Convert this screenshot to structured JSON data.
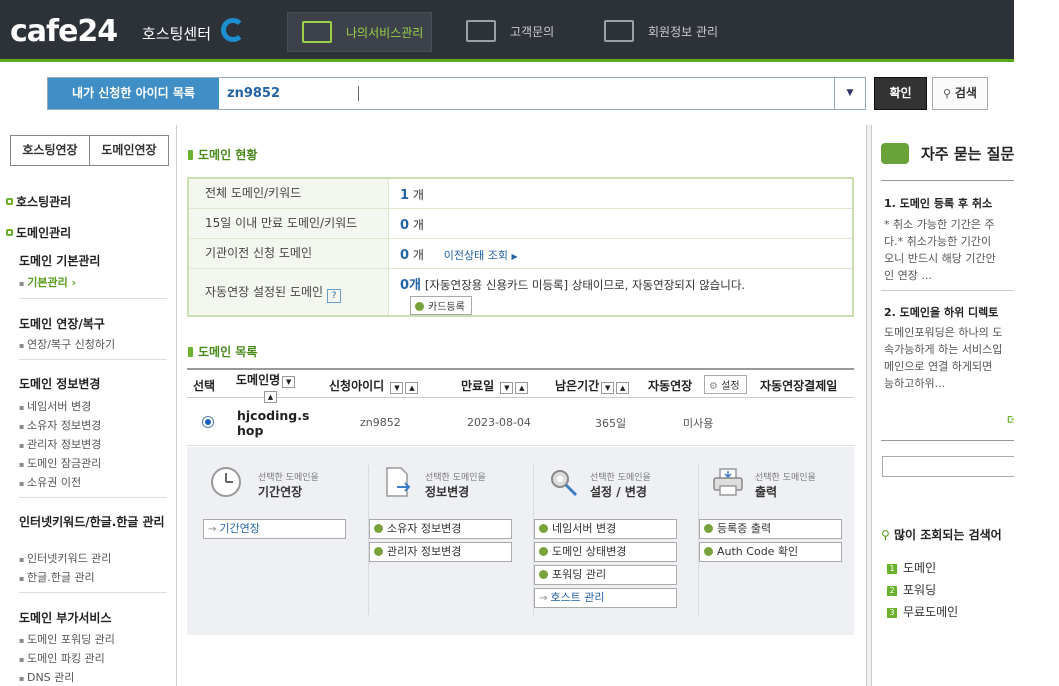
{
  "header": {
    "logo": "cafe24",
    "logo_sub": "호스팅센터",
    "nav": [
      {
        "label": "나의서비스관리",
        "icon": "service-gear-icon"
      },
      {
        "label": "고객문의",
        "icon": "customer-inquiry-icon"
      },
      {
        "label": "회원정보 관리",
        "icon": "member-info-icon"
      }
    ]
  },
  "id_search": {
    "label": "내가 신청한 아이디 목록",
    "value": "zn9852",
    "confirm_label": "확인",
    "search_label": "검색"
  },
  "sidebar": {
    "tabs": [
      "호스팅연장",
      "도메인연장"
    ],
    "sections": [
      "호스팅관리",
      "도메인관리"
    ],
    "groups": [
      {
        "title": "도메인 기본관리",
        "items": [
          "기본관리"
        ]
      },
      {
        "title": "도메인 연장/복구",
        "items": [
          "연장/복구 신청하기"
        ]
      },
      {
        "title": "도메인 정보변경",
        "items": [
          "네임서버 변경",
          "소유자 정보변경",
          "관리자 정보변경",
          "도메인 잠금관리",
          "소유권 이전"
        ]
      },
      {
        "title": "인터넷키워드/한글.한글 관리",
        "items": [
          "인터넷키워드 관리",
          "한글.한글 관리"
        ]
      },
      {
        "title": "도메인 부가서비스",
        "items": [
          "도메인 포워딩 관리",
          "도메인 파킹 관리",
          "DNS 관리"
        ]
      }
    ]
  },
  "domain_status": {
    "title": "도메인 현황",
    "rows": [
      {
        "label": "전체 도메인/키워드",
        "count": "1",
        "unit": "개"
      },
      {
        "label": "15일 이내 만료 도메인/키워드",
        "count": "0",
        "unit": "개"
      },
      {
        "label": "기관이전 신청 도메인",
        "count": "0",
        "unit": "개",
        "link": "이전상태 조회"
      },
      {
        "label": "자동연장 설정된 도메인",
        "count": "0개",
        "note": "[자동연장용 신용카드 미등록] 상태이므로, 자동연장되지 않습니다.",
        "button": "카드등록"
      }
    ]
  },
  "domain_list": {
    "title": "도메인 목록",
    "columns": {
      "select": "선택",
      "domain": "도메인명",
      "id": "신청아이디",
      "expiry": "만료일",
      "remaining": "남은기간",
      "auto_renew": "자동연장",
      "setting": "설정",
      "auto_pay": "자동연장결제일"
    },
    "rows": [
      {
        "domain_line1": "hjcoding.s",
        "domain_line2": "hop",
        "id": "zn9852",
        "expiry": "2023-08-04",
        "remaining": "365일",
        "auto_renew": "미사용"
      }
    ]
  },
  "actions": {
    "subtitle": "선택한 도메인을",
    "columns": [
      {
        "title": "기간연장",
        "icon": "clock-icon",
        "buttons": [
          {
            "label": "기간연장",
            "style": "link"
          }
        ]
      },
      {
        "title": "정보변경",
        "icon": "document-arrow-icon",
        "buttons": [
          {
            "label": "소유자 정보변경"
          },
          {
            "label": "관리자 정보변경"
          }
        ]
      },
      {
        "title": "설정 / 변경",
        "icon": "wrench-gear-icon",
        "buttons": [
          {
            "label": "네임서버 변경"
          },
          {
            "label": "도메인 상태변경"
          },
          {
            "label": "포워딩 관리"
          },
          {
            "label": "호스트 관리",
            "style": "link"
          }
        ]
      },
      {
        "title": "출력",
        "icon": "printer-icon",
        "buttons": [
          {
            "label": "등록증 출력"
          },
          {
            "label": "Auth Code 확인"
          }
        ]
      }
    ]
  },
  "faq": {
    "title": "자주 묻는 질문",
    "items": [
      {
        "q": "1. 도메인 등록 후 취소",
        "lines": [
          "* 취소 가능한 기간은 주",
          "다.* 취소가능한 기간이",
          "오니 반드시 해당 기간안",
          "인 연장 ..."
        ]
      },
      {
        "q": "2. 도메인을 하위 디렉토",
        "lines": [
          "도메인포워딩은 하나의 도",
          "속가능하게 하는 서비스입",
          "메인으로 연결 하게되면",
          "능하고하위..."
        ]
      }
    ],
    "more": "더"
  },
  "popular": {
    "title": "많이 조회되는 검색어",
    "items": [
      "도메인",
      "포워딩",
      "무료도메인"
    ]
  },
  "colors": {
    "accent_green": "#6ab12d",
    "link_blue": "#2463a6",
    "header_bg": "#2d3138"
  }
}
